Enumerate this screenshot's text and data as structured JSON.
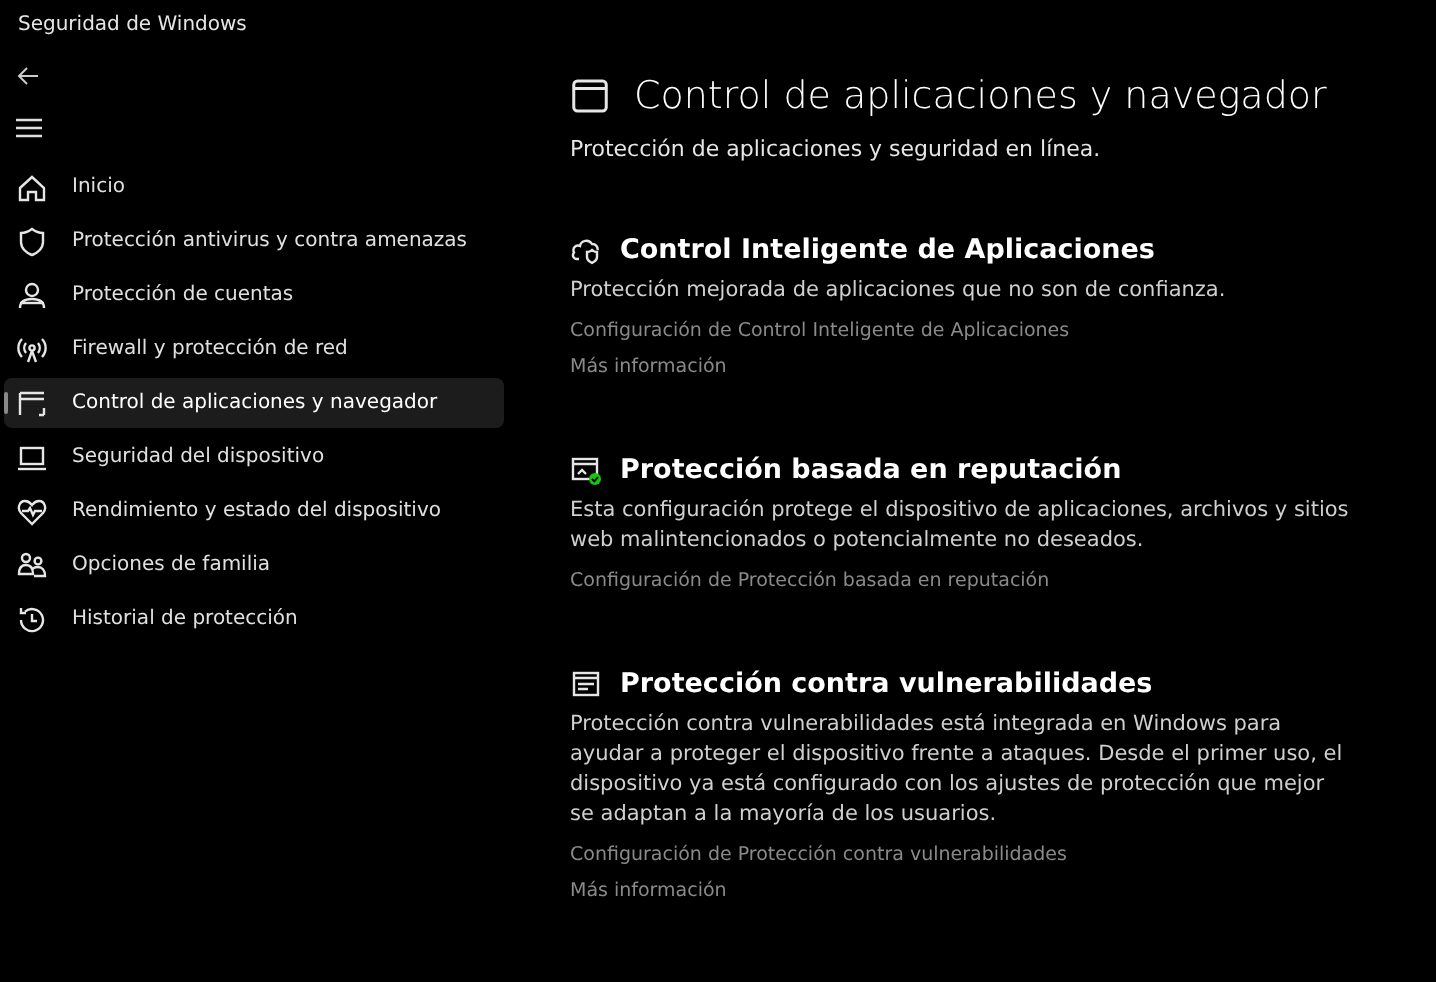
{
  "window": {
    "title": "Seguridad de Windows"
  },
  "sidebar": {
    "items": [
      {
        "label": "Inicio",
        "selected": false
      },
      {
        "label": "Protección antivirus y contra amenazas",
        "selected": false
      },
      {
        "label": "Protección de cuentas",
        "selected": false
      },
      {
        "label": "Firewall y protección de red",
        "selected": false
      },
      {
        "label": "Control de aplicaciones y navegador",
        "selected": true
      },
      {
        "label": "Seguridad del dispositivo",
        "selected": false
      },
      {
        "label": "Rendimiento y estado del dispositivo",
        "selected": false
      },
      {
        "label": "Opciones de familia",
        "selected": false
      },
      {
        "label": "Historial de protección",
        "selected": false
      }
    ]
  },
  "page": {
    "title": "Control de aplicaciones y navegador",
    "subtitle": "Protección de aplicaciones y seguridad en línea."
  },
  "sections": [
    {
      "title": "Control Inteligente de Aplicaciones",
      "description": "Protección mejorada de aplicaciones que no son de confianza.",
      "links": [
        "Configuración de Control Inteligente de Aplicaciones",
        "Más información"
      ]
    },
    {
      "title": "Protección basada en reputación",
      "description": "Esta configuración protege el dispositivo de aplicaciones, archivos y sitios web malintencionados o potencialmente no deseados.",
      "links": [
        "Configuración de Protección basada en reputación"
      ]
    },
    {
      "title": "Protección contra vulnerabilidades",
      "description": "Protección contra vulnerabilidades está integrada en Windows para ayudar a proteger el dispositivo frente a ataques. Desde el primer uso, el dispositivo ya está configurado con los ajustes de protección que mejor se adaptan a la mayoría de los usuarios.",
      "links": [
        "Configuración de Protección contra vulnerabilidades",
        "Más información"
      ]
    }
  ]
}
